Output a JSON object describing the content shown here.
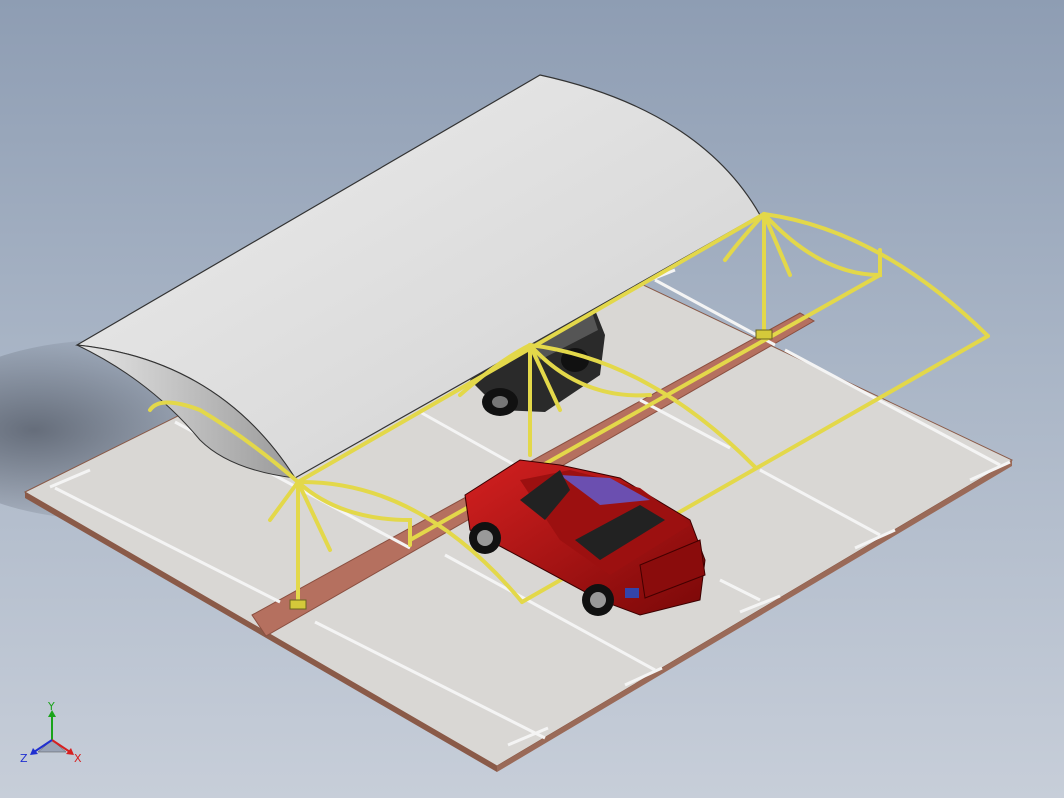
{
  "viewport": {
    "background_top": "#8e9db3",
    "background_bottom": "#c7ced9"
  },
  "scene": {
    "pavement_color": "#d9d7d4",
    "pavement_edge_color": "#8a5a48",
    "divider_color": "#b5705f",
    "canopy_color": "#dedede",
    "frame_color": "#e3d84a",
    "car_color": "#b01414",
    "car_sunroof_color": "#6b4fb0",
    "parking_line_color": "#f2f2f2",
    "icons": [
      "parking-lot",
      "carport-canopy",
      "steel-frame",
      "red-suv",
      "black-car",
      "coordinate-triad"
    ]
  },
  "triad": {
    "x_label": "X",
    "y_label": "Y",
    "z_label": "Z",
    "x_color": "#d62020",
    "y_color": "#1aa31a",
    "z_color": "#2030d0"
  }
}
